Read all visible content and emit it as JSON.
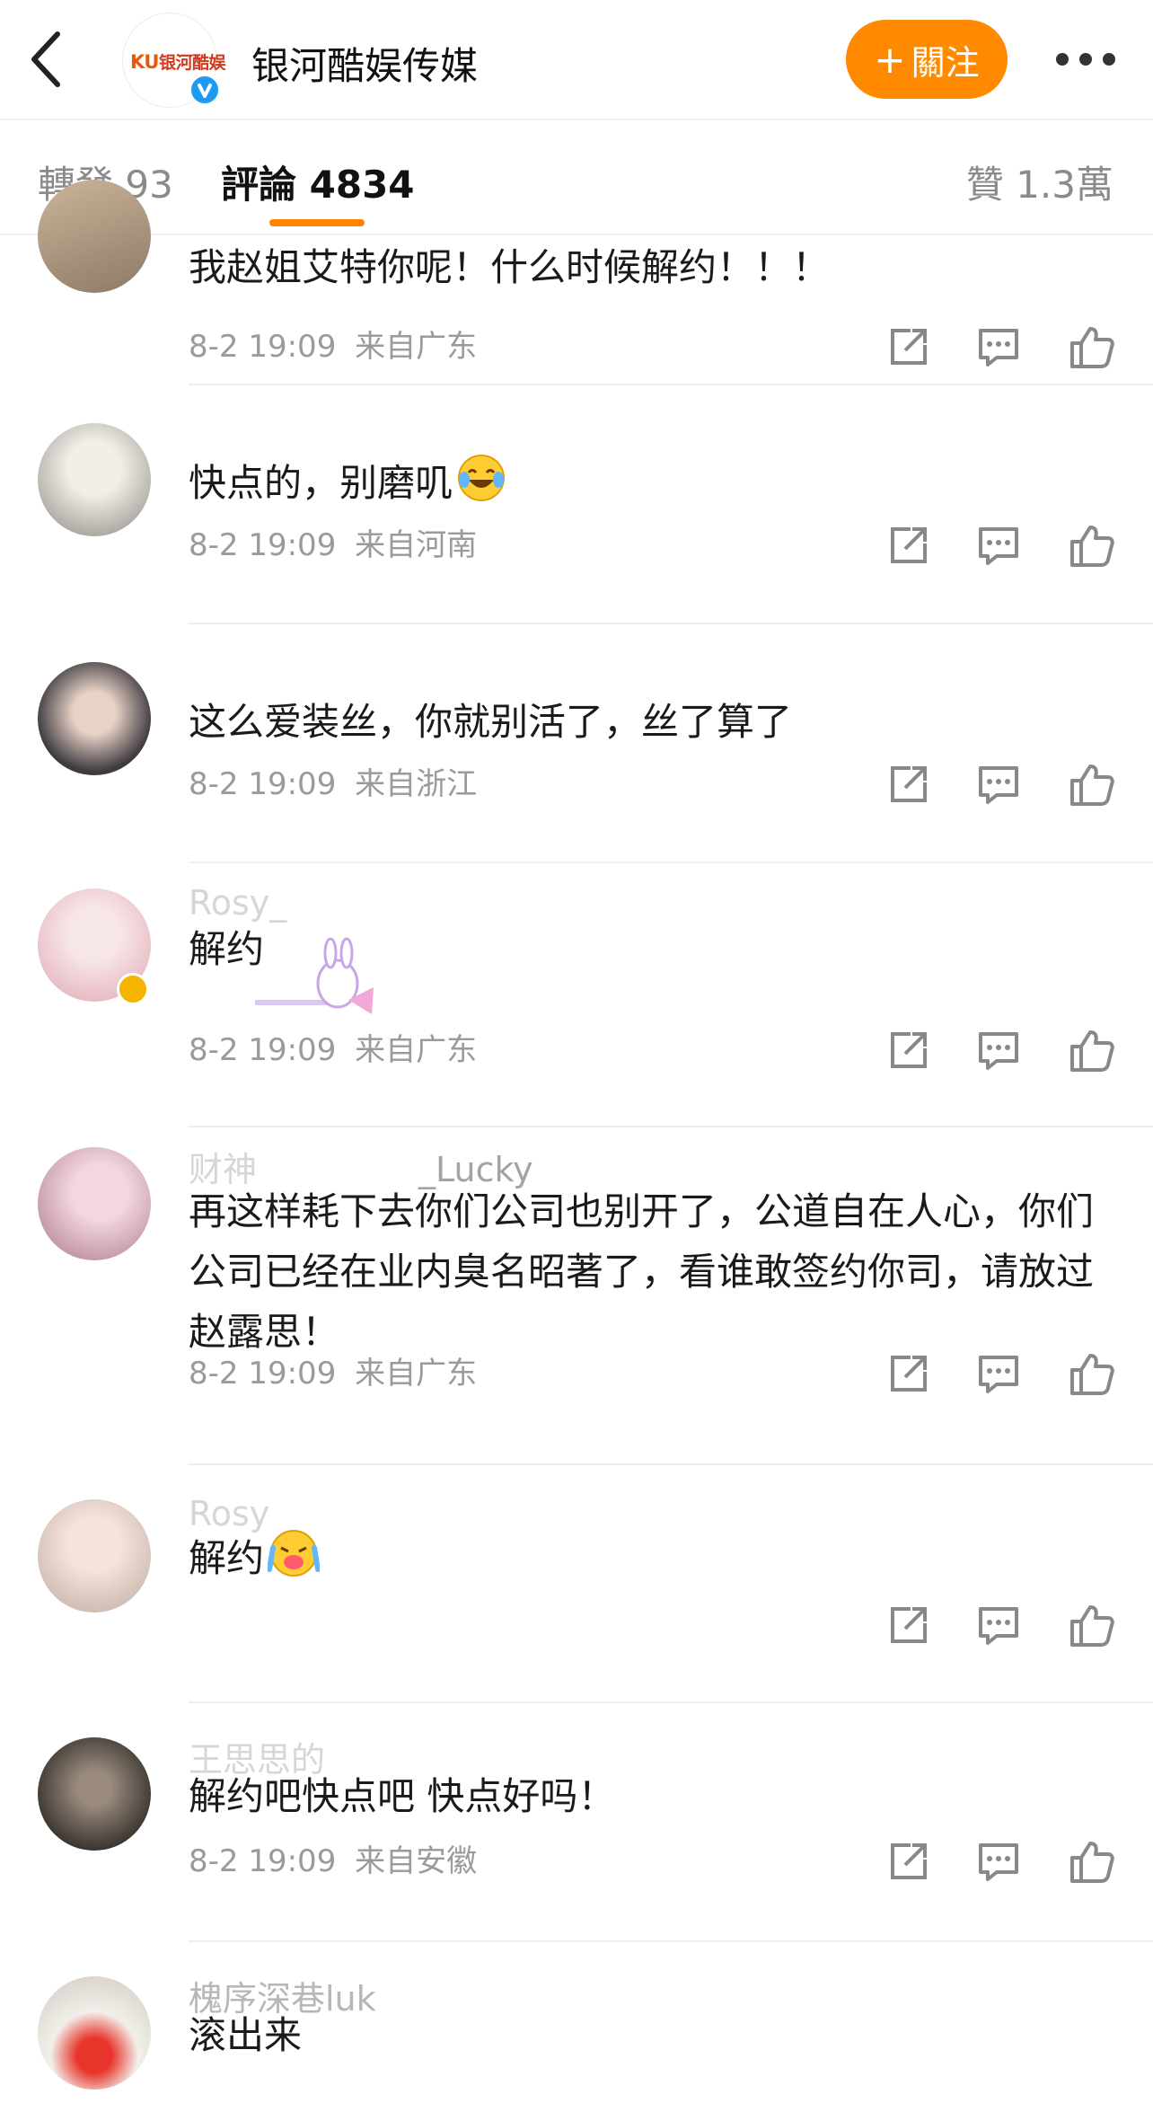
{
  "header": {
    "back_icon": "chevron-left-icon",
    "logo": {
      "ku": "KU",
      "name": "银河酷娱"
    },
    "account_name": "银河酷娱传媒",
    "follow_plus": "+",
    "follow_label": "關注",
    "more_icon": "more-dots-icon",
    "colors": {
      "accent": "#ff8200",
      "follow_button": "#ff8a00",
      "verified": "#1d9bf0"
    }
  },
  "tabs": {
    "repost": "轉發 93",
    "comments": "評論 4834",
    "likes": "贊 1.3萬"
  },
  "comments": [
    {
      "username": "",
      "text": "我赵姐艾特你呢！什么时候解约！！！",
      "time": "8-2 19:09",
      "location": "来自广东"
    },
    {
      "username": "",
      "text": "快点的，别磨叽",
      "emoji": "laugh-cry-emoji",
      "time": "8-2 19:09",
      "location": "来自河南"
    },
    {
      "username": "",
      "text": "这么爱装丝，你就别活了，丝了算了",
      "time": "8-2 19:09",
      "location": "来自浙江"
    },
    {
      "username": "Rosy_",
      "text": "解约",
      "time": "8-2 19:09",
      "location": "来自广东"
    },
    {
      "username": "财神",
      "username_tail": "_Lucky",
      "text": "再这样耗下去你们公司也别开了，公道自在人心，你们公司已经在业内臭名昭著了，看谁敢签约你司，请放过赵露思！",
      "time": "8-2 19:09",
      "location": "来自广东"
    },
    {
      "username": "Rosy",
      "text": "解约",
      "emoji": "cry-joy-emoji",
      "time": "",
      "location": ""
    },
    {
      "username": "王思思的",
      "text": "解约吧快点吧  快点好吗！",
      "time": "8-2 19:09",
      "location": "来自安徽"
    },
    {
      "username": "槐序深巷luk",
      "text": "滚出来",
      "time": "",
      "location": ""
    }
  ]
}
